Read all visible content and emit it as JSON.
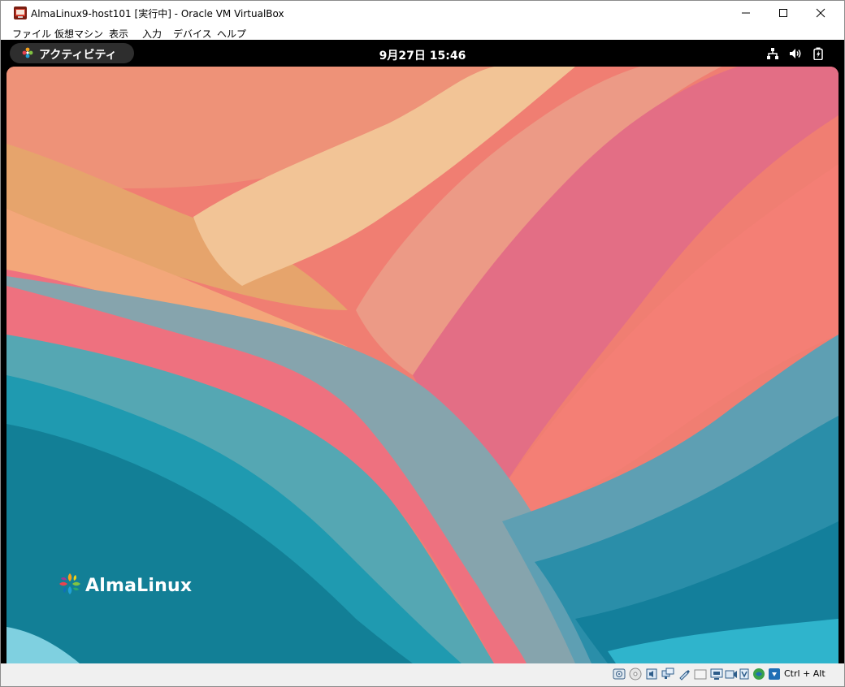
{
  "window": {
    "title": "AlmaLinux9-host101 [実行中] - Oracle VM VirtualBox",
    "controls": [
      "minimize",
      "maximize",
      "close"
    ]
  },
  "menubar": {
    "items": [
      {
        "label": "ファイル"
      },
      {
        "label": "仮想マシン"
      },
      {
        "label": "表示"
      },
      {
        "label": "入力"
      },
      {
        "label": "デバイス"
      },
      {
        "label": "ヘルプ"
      }
    ]
  },
  "gnome": {
    "activities_label": "アクティビティ",
    "clock": "9月27日  15:46",
    "tray": [
      "network-icon",
      "volume-icon",
      "battery-icon"
    ]
  },
  "desktop": {
    "logo_text": "AlmaLinux",
    "colors": {
      "coral": "#f4826f",
      "pink": "#e4677f",
      "peach": "#f2bf8f",
      "teal": "#1f9ab0",
      "deep_teal": "#127f96"
    }
  },
  "statusbar": {
    "icons": [
      "hard-disk-icon",
      "optical-drive-icon",
      "audio-icon",
      "network-adapter-icon",
      "usb-icon",
      "shared-folder-icon",
      "display-icon",
      "recording-icon",
      "cpu-icon",
      "mouse-integration-icon",
      "keyboard-capture-icon"
    ],
    "host_key": "Ctrl + Alt"
  }
}
